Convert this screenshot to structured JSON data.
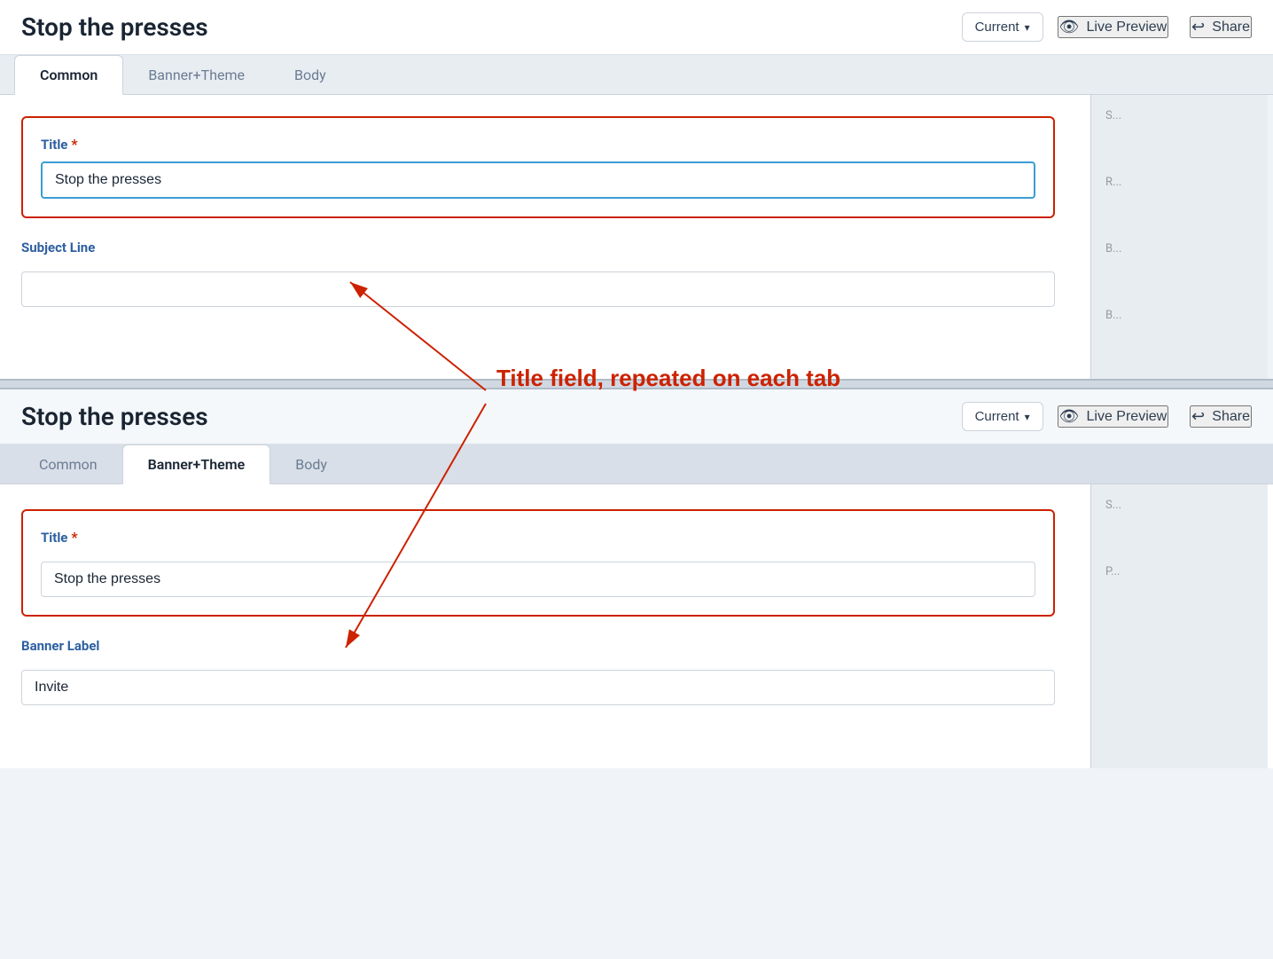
{
  "page": {
    "title": "Stop the presses"
  },
  "top": {
    "header": {
      "title": "Stop the presses",
      "dropdown_label": "Current",
      "dropdown_icon": "▾",
      "live_preview_label": "Live Preview",
      "share_label": "Share"
    },
    "tabs": [
      {
        "id": "common",
        "label": "Common",
        "active": true
      },
      {
        "id": "banner-theme",
        "label": "Banner+Theme",
        "active": false
      },
      {
        "id": "body",
        "label": "Body",
        "active": false
      }
    ],
    "form": {
      "title_label": "Title",
      "title_required": "*",
      "title_value": "Stop the presses",
      "subject_line_label": "Subject Line",
      "subject_line_value": ""
    }
  },
  "bottom": {
    "header": {
      "title": "Stop the presses",
      "dropdown_label": "Current",
      "dropdown_icon": "▾",
      "live_preview_label": "Live Preview",
      "share_label": "Share"
    },
    "tabs": [
      {
        "id": "common",
        "label": "Common",
        "active": false
      },
      {
        "id": "banner-theme",
        "label": "Banner+Theme",
        "active": true
      },
      {
        "id": "body",
        "label": "Body",
        "active": false
      }
    ],
    "form": {
      "title_label": "Title",
      "title_required": "*",
      "title_value": "Stop the presses",
      "banner_label_label": "Banner Label",
      "banner_label_value": "Invite"
    }
  },
  "annotation": {
    "text": "Title field, repeated on each tab"
  },
  "icons": {
    "eye": "👁",
    "share": "↪",
    "chevron_down": "∨"
  }
}
